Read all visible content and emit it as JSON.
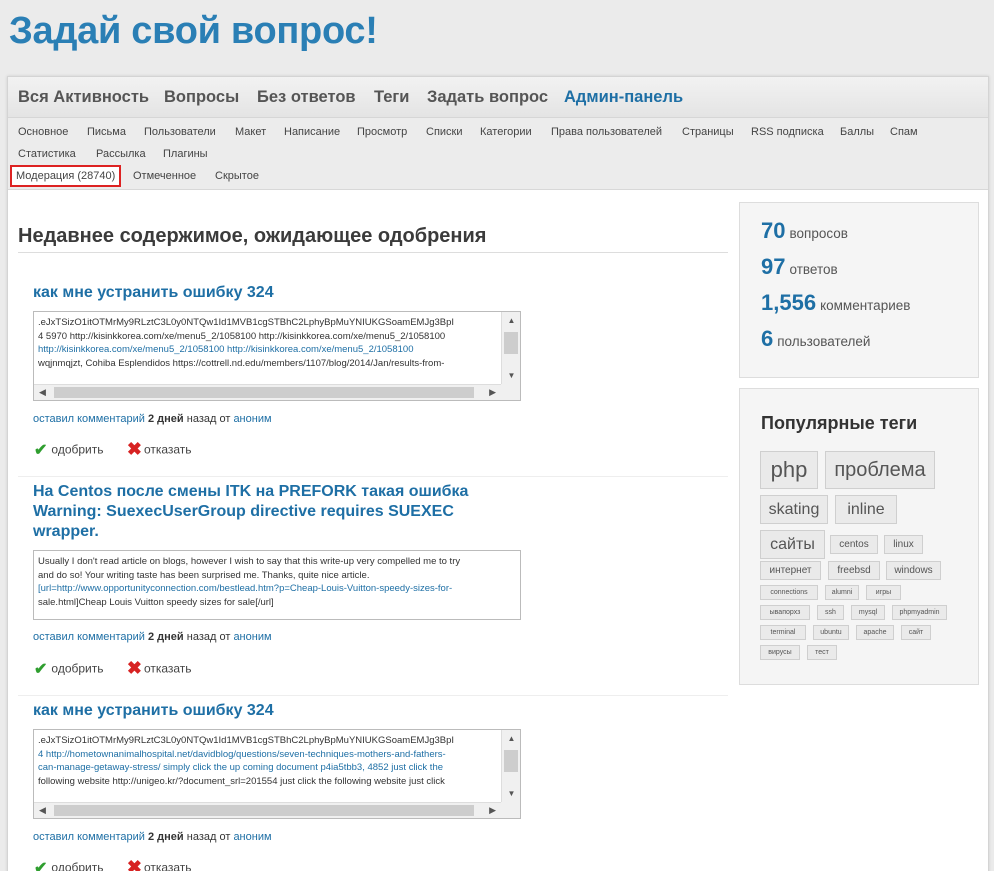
{
  "site_title": "Задай свой вопрос!",
  "nav_main": [
    "Вся Активность",
    "Вопросы",
    "Без ответов",
    "Теги",
    "Задать вопрос",
    "Админ-панель"
  ],
  "nav_sub_row1": [
    "Основное",
    "Письма",
    "Пользователи",
    "Макет",
    "Написание",
    "Просмотр",
    "Списки",
    "Категории",
    "Права пользователей",
    "Страницы",
    "RSS подписка",
    "Баллы",
    "Спам"
  ],
  "nav_sub_row2": [
    "Статистика",
    "Рассылка",
    "Плагины"
  ],
  "nav_sub_row3": [
    "Модерация (28740)",
    "Отмеченное",
    "Скрытое"
  ],
  "section_title": "Недавнее содержимое, ожидающее одобрения",
  "posts": [
    {
      "title": "как мне устранить ошибку 324",
      "lines": [
        ".eJxTSizO1itOTMrMy9RLztC3L0y0NTQw1Id1MVB1cgSTBhC2LphyBpMuYNIUKGSoamEMJg3BpI",
        "4  5970 http://kisinkkorea.com/xe/menu5_2/1058100 http://kisinkkorea.com/xe/menu5_2/1058100",
        "http://kisinkkorea.com/xe/menu5_2/1058100 http://kisinkkorea.com/xe/menu5_2/1058100",
        "wqjnmqjzt, Cohiba Esplendidos https://cottrell.nd.edu/members/1107/blog/2014/Jan/results-from-"
      ],
      "meta_link": "оставил комментарий",
      "meta_when": "2 дней",
      "meta_mid": "назад от",
      "meta_author": "аноним",
      "approve": "одобрить",
      "reject": "отказать"
    },
    {
      "title": "На Centos после смены ITK на PREFORK такая ошибка Warning: SuexecUserGroup directive requires SUEXEC wrapper.",
      "lines": [
        "Usually I don't read article on blogs, however I wish to say that this write-up very compelled me to try",
        "and do so! Your writing taste has been surprised me. Thanks, quite nice article.",
        "[url=http://www.opportunityconnection.com/bestlead.htm?p=Cheap-Louis-Vuitton-speedy-sizes-for-",
        "sale.html]Cheap Louis Vuitton speedy sizes for sale[/url]"
      ],
      "meta_link": "оставил комментарий",
      "meta_when": "2 дней",
      "meta_mid": "назад от",
      "meta_author": "аноним",
      "approve": "одобрить",
      "reject": "отказать"
    },
    {
      "title": "как мне устранить ошибку 324",
      "lines": [
        ".eJxTSizO1itOTMrMy9RLztC3L0y0NTQw1Id1MVB1cgSTBhC2LphyBpMuYNIUKGSoamEMJg3BpI",
        "4 http://hometownanimalhospital.net/davidblog/questions/seven-techniques-mothers-and-fathers-",
        "can-manage-getaway-stress/ simply click the up coming document p4ia5tbb3,  4852 just click the",
        "following website http://unigeo.kr/?document_srl=201554 just click the following website just click"
      ],
      "meta_link": "оставил комментарий",
      "meta_when": "2 дней",
      "meta_mid": "назад от",
      "meta_author": "аноним",
      "approve": "одобрить",
      "reject": "отказать"
    }
  ],
  "stats": [
    {
      "num": "70",
      "label": "вопросов"
    },
    {
      "num": "97",
      "label": "ответов"
    },
    {
      "num": "1,556",
      "label": "комментариев"
    },
    {
      "num": "6",
      "label": "пользователей"
    }
  ],
  "tags_title": "Популярные теги",
  "tags": [
    "php",
    "проблема",
    "skating",
    "inline",
    "сайты",
    "centos",
    "linux",
    "интернет",
    "freebsd",
    "windows",
    "connections",
    "alumni",
    "игры",
    "ывапорхз",
    "ssh",
    "mysql",
    "phpmyadmin",
    "terminal",
    "ubuntu",
    "apache",
    "сайт",
    "вирусы",
    "тест"
  ],
  "colors": {
    "link": "#1e6fa5",
    "title": "#2a7fb5",
    "approve": "#2f9e2f",
    "reject": "#d72222",
    "selected_border": "#dd2222"
  },
  "icons": {
    "approve": "checkmark-icon",
    "reject": "cross-icon"
  }
}
